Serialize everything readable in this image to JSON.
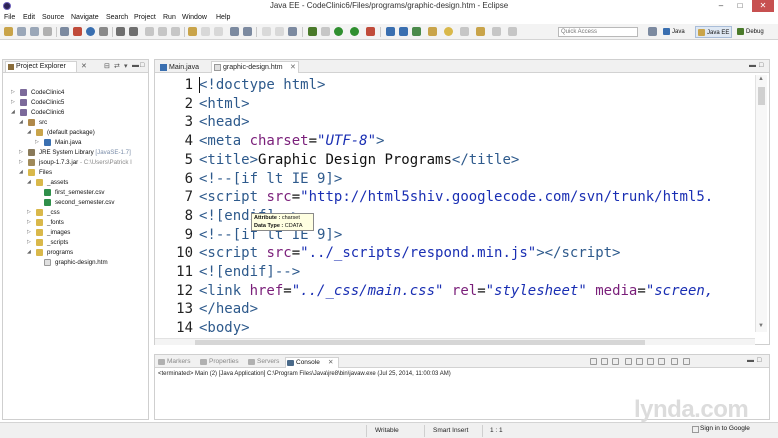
{
  "window": {
    "title": "Java EE - CodeClinic6/Files/programs/graphic-design.htm - Eclipse",
    "minimize": "–",
    "maximize": "□",
    "close": "✕"
  },
  "menu": [
    "File",
    "Edit",
    "Source",
    "Navigate",
    "Search",
    "Project",
    "Run",
    "Window",
    "Help"
  ],
  "toolbar": {
    "quick_access_placeholder": "Quick Access",
    "perspectives": [
      "Java",
      "Java EE",
      "Debug"
    ]
  },
  "project_explorer": {
    "title": "Project Explorer",
    "tree": [
      {
        "label": "CodeClinic4"
      },
      {
        "label": "CodeClinic5"
      },
      {
        "label": "CodeClinic6"
      },
      {
        "label": "src"
      },
      {
        "label": "(default package)"
      },
      {
        "label": "Main.java"
      },
      {
        "label": "JRE System Library",
        "decoration": "[JavaSE-1.7]"
      },
      {
        "label": "jsoup-1.7.3.jar",
        "decoration": "- C:\\Users\\Patrick I"
      },
      {
        "label": "Files"
      },
      {
        "label": "_assets"
      },
      {
        "label": "first_semester.csv"
      },
      {
        "label": "second_semester.csv"
      },
      {
        "label": "_css"
      },
      {
        "label": "_fonts"
      },
      {
        "label": "_images"
      },
      {
        "label": "_scripts"
      },
      {
        "label": "programs"
      },
      {
        "label": "graphic-design.htm"
      }
    ]
  },
  "editor": {
    "tabs": [
      "Main.java",
      "graphic-design.htm"
    ],
    "active_tab": "graphic-design.htm",
    "line_numbers": [
      "1",
      "2",
      "3",
      "4",
      "5",
      "6",
      "7",
      "8",
      "9",
      "10",
      "11",
      "12",
      "13",
      "14"
    ],
    "tooltip": {
      "attribute_label": "Attribute :",
      "attribute_value": "charset",
      "datatype_label": "Data Type :",
      "datatype_value": "CDATA"
    }
  },
  "bottom_panel": {
    "tabs": [
      "Markers",
      "Properties",
      "Servers",
      "Console"
    ],
    "active_tab": "Console",
    "console_text": "<terminated> Main (2) [Java Application] C:\\Program Files\\Java\\jre8\\bin\\javaw.exe (Jul 25, 2014, 11:00:03 AM)"
  },
  "status_bar": {
    "mode": "Writable",
    "insert": "Smart Insert",
    "position": "1 : 1"
  },
  "watermark": {
    "brand": "lynda.com",
    "sign_in": "Sign in to Google"
  }
}
